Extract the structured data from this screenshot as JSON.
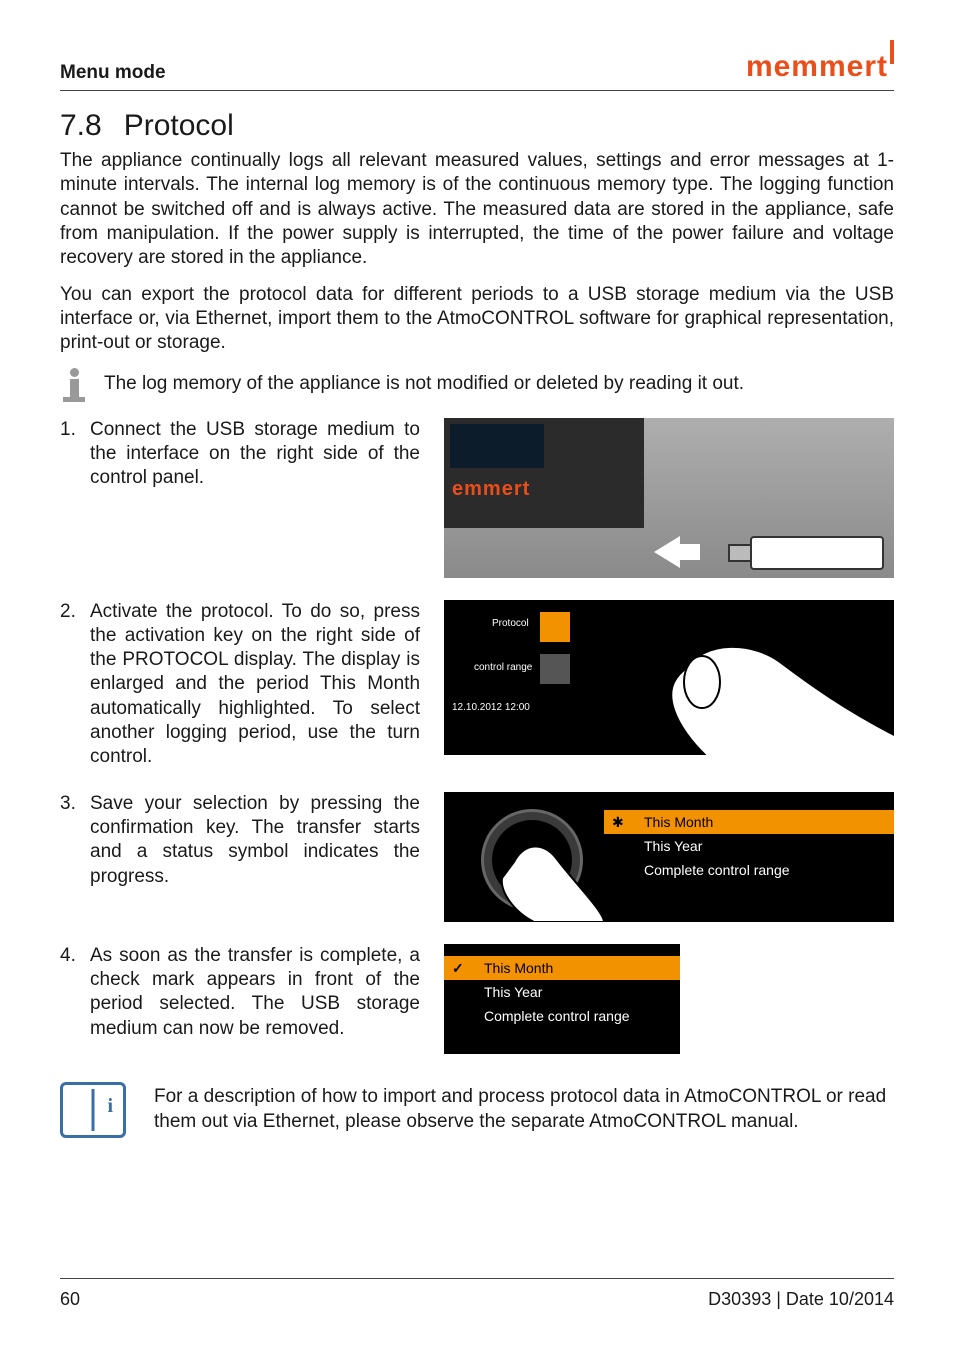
{
  "header": {
    "section_title": "Menu mode",
    "brand": "memmert"
  },
  "section": {
    "number": "7.8",
    "title": "Protocol"
  },
  "paragraphs": {
    "p1": "The appliance continually logs all relevant measured values, settings and error messages at 1-minute intervals. The internal log memory is of the continuous memory type. The logging function cannot be switched off and is always active. The measured data are stored in the appliance, safe from manipulation. If the power supply is interrupted, the time of the power failure and voltage recovery are stored in the appliance.",
    "p2": "You can export the protocol data for different periods to a USB storage medium via the USB interface or, via Ethernet, import them to the AtmoCONTROL software for graphical representation, print-out or storage.",
    "info": "The log memory of the appliance is not modified or deleted by reading it out."
  },
  "steps": [
    {
      "n": "1.",
      "text": "Connect the USB storage medium to the interface on the right side of the control panel."
    },
    {
      "n": "2.",
      "text_pre": "Activate the protocol. To do so, press the activation key on the right side of the ",
      "kw1": "PROTOCOL",
      "text_mid": " display. The display is enlarged and the period ",
      "kw2": "This Month",
      "text_post": " automatically highlighted. To select another logging period, use the turn control."
    },
    {
      "n": "3.",
      "text": "Save your selection by pressing the confirmation key. The transfer starts and a status symbol indicates the progress."
    },
    {
      "n": "4.",
      "text": "As soon as the transfer is complete, a check mark appears in front of the period selected. The USB storage medium can now be removed."
    }
  ],
  "ill1": {
    "device_brand": "emmert"
  },
  "ill2": {
    "labels": {
      "protocol": "Protocol",
      "control_range": "control range",
      "timestamp": "12.10.2012  12:00"
    }
  },
  "menu3": {
    "items": [
      {
        "label": "This Month",
        "selected": true
      },
      {
        "label": "This Year",
        "selected": false
      },
      {
        "label": "Complete control range",
        "selected": false
      }
    ]
  },
  "menu4": {
    "items": [
      {
        "label": "This Month",
        "selected": true,
        "done": true
      },
      {
        "label": "This Year",
        "selected": false
      },
      {
        "label": "Complete control range",
        "selected": false
      }
    ]
  },
  "book_note": "For a description of how to import and process protocol data in AtmoCONTROL or read them out via Ethernet, please observe the separate AtmoCONTROL manual.",
  "footer": {
    "page": "60",
    "doc_id": "D30393 | Date 10/2014"
  }
}
